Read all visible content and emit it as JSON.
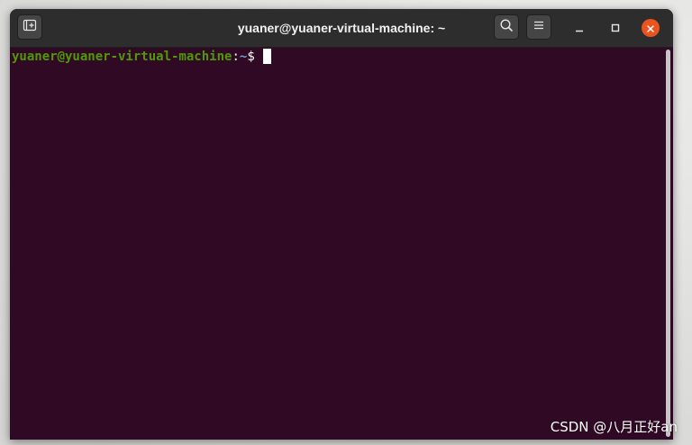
{
  "window": {
    "title": "yuaner@yuaner-virtual-machine: ~"
  },
  "titlebar": {
    "new_tab_icon": "new-tab-icon",
    "search_icon": "search-icon",
    "menu_icon": "hamburger-menu-icon",
    "minimize_icon": "minimize-icon",
    "maximize_icon": "maximize-icon",
    "close_icon": "close-icon"
  },
  "terminal": {
    "prompt": {
      "user_host": "yuaner@yuaner-virtual-machine",
      "colon": ":",
      "path": "~",
      "symbol": "$"
    }
  },
  "watermark": "CSDN @八月正好an",
  "colors": {
    "terminal_bg": "#300a24",
    "titlebar_bg": "#2d2d2d",
    "prompt_user": "#4e9a06",
    "prompt_path": "#729fcf",
    "close_button": "#e95420"
  }
}
